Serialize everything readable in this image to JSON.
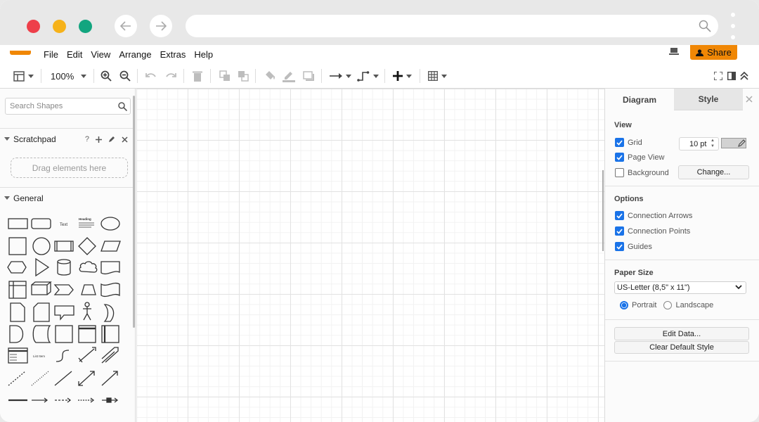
{
  "menu": {
    "items": [
      "File",
      "Edit",
      "View",
      "Arrange",
      "Extras",
      "Help"
    ],
    "share_label": "Share"
  },
  "toolbar": {
    "zoom": "100%"
  },
  "sidebar": {
    "search_placeholder": "Search Shapes",
    "scratchpad_title": "Scratchpad",
    "scratchpad_help": "?",
    "drop_hint": "Drag elements here",
    "general_title": "General",
    "shape_labels": {
      "text": "Text",
      "heading": "Heading",
      "list_item": "List Item"
    }
  },
  "panel": {
    "tabs": [
      "Diagram",
      "Style"
    ],
    "view_title": "View",
    "grid_label": "Grid",
    "grid_size": "10 pt",
    "page_view_label": "Page View",
    "background_label": "Background",
    "change_button": "Change...",
    "options_title": "Options",
    "connection_arrows_label": "Connection Arrows",
    "connection_points_label": "Connection Points",
    "guides_label": "Guides",
    "paper_size_title": "Paper Size",
    "paper_size_value": "US-Letter (8,5\" x 11\")",
    "portrait_label": "Portrait",
    "landscape_label": "Landscape",
    "edit_data_button": "Edit Data...",
    "clear_style_button": "Clear Default Style",
    "grid_color": "#d2d2d2",
    "accent_color": "#1a73e8"
  },
  "state": {
    "grid_checked": true,
    "page_view_checked": true,
    "background_checked": false,
    "connection_arrows_checked": true,
    "connection_points_checked": true,
    "guides_checked": true,
    "orientation": "Portrait"
  },
  "icons": {
    "browser": [
      "back-arrow-icon",
      "forward-arrow-icon",
      "search-icon",
      "kebab-menu-icon"
    ],
    "toolbar": [
      "format-panel-icon",
      "zoom-in-icon",
      "zoom-out-icon",
      "undo-icon",
      "redo-icon",
      "delete-icon",
      "to-front-icon",
      "to-back-icon",
      "fill-color-icon",
      "line-color-icon",
      "shadow-icon",
      "connection-icon",
      "waypoint-icon",
      "insert-plus-icon",
      "table-icon",
      "fullscreen-icon",
      "toggle-panel-icon",
      "collapse-icon"
    ]
  },
  "colors": {
    "brand": "#f08705",
    "close_red": "#ee3f4a",
    "minimize_yellow": "#f6b21a",
    "maximize_green": "#12a57f"
  }
}
